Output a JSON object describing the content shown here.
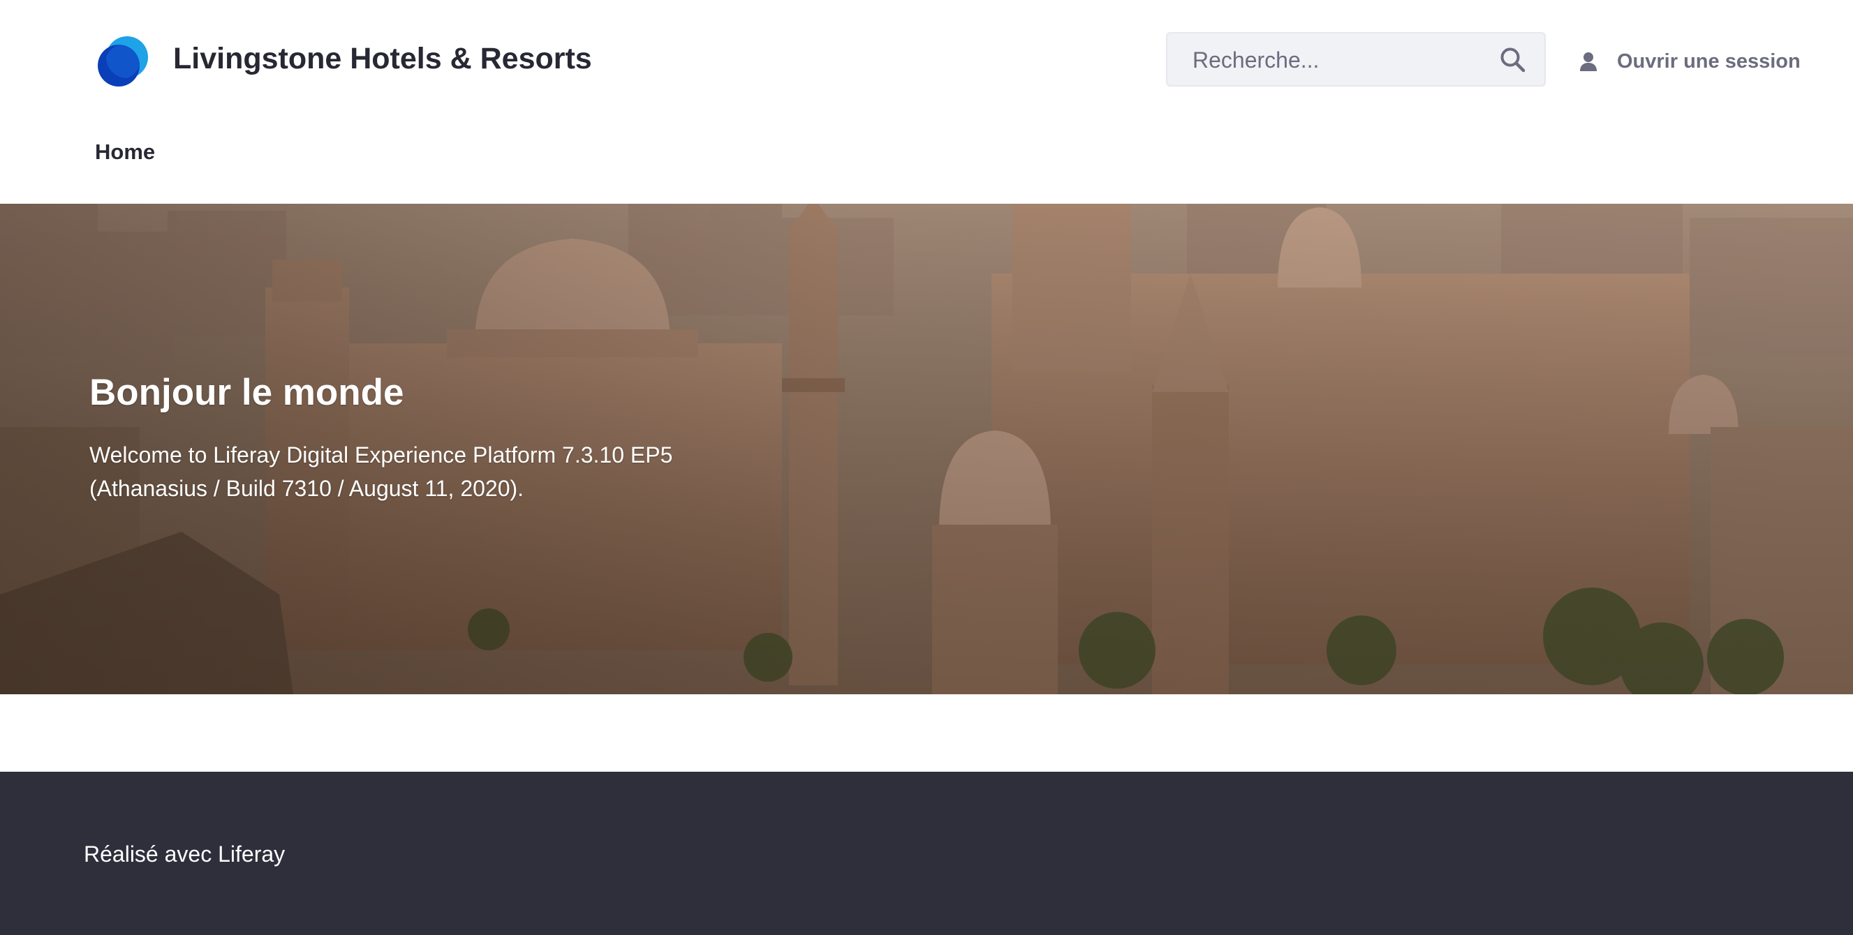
{
  "header": {
    "site_name": "Livingstone Hotels & Resorts",
    "logo_icon": "liferay-logo-icon",
    "search": {
      "placeholder": "Recherche...",
      "value": "",
      "icon": "search-icon"
    },
    "signin": {
      "label": "Ouvrir une session",
      "icon": "user-icon"
    },
    "nav": {
      "items": [
        {
          "label": "Home"
        }
      ]
    }
  },
  "hero": {
    "title": "Bonjour le monde",
    "body": "Welcome to Liferay Digital Experience Platform 7.3.10 EP5 (Athanasius / Build 7310 / August 11, 2020)."
  },
  "footer": {
    "powered_by": "Réalisé avec Liferay"
  },
  "colors": {
    "text_dark": "#272833",
    "text_muted": "#6b6c7e",
    "footer_bg": "#2e2f3b",
    "search_bg": "#f1f2f5",
    "logo_dark_blue": "#0b5fff",
    "logo_light_blue": "#1ea2e8"
  }
}
